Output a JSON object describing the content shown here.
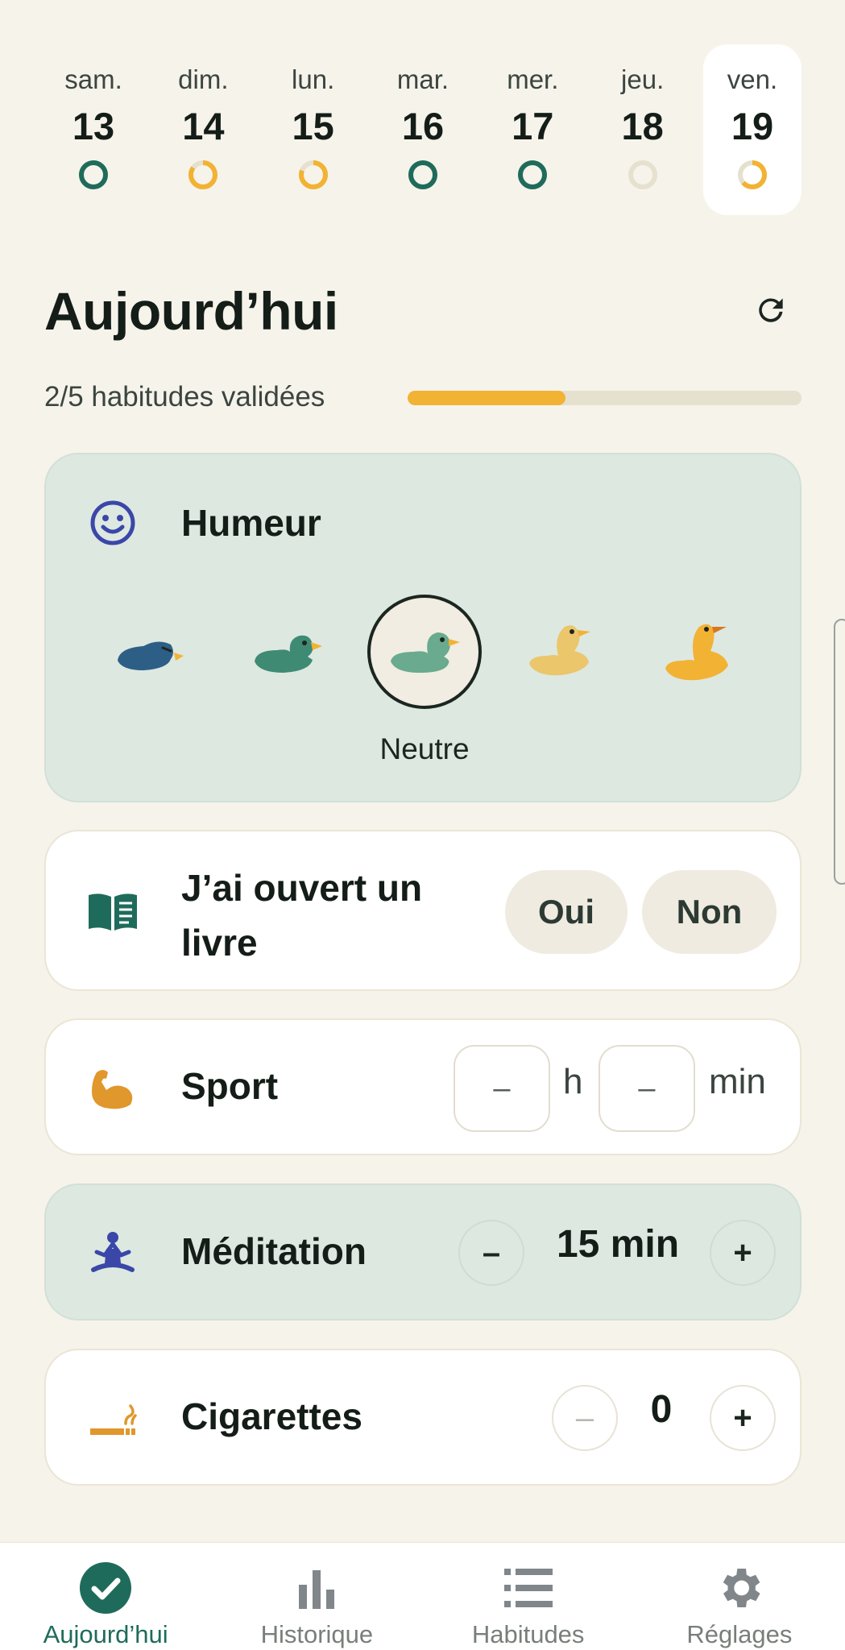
{
  "days": [
    {
      "name": "sam.",
      "num": "13",
      "status": "complete"
    },
    {
      "name": "dim.",
      "num": "14",
      "status": "partial"
    },
    {
      "name": "lun.",
      "num": "15",
      "status": "partial"
    },
    {
      "name": "mar.",
      "num": "16",
      "status": "complete"
    },
    {
      "name": "mer.",
      "num": "17",
      "status": "complete"
    },
    {
      "name": "jeu.",
      "num": "18",
      "status": "empty"
    },
    {
      "name": "ven.",
      "num": "19",
      "status": "partial",
      "selected": true
    }
  ],
  "header": {
    "title": "Aujourd’hui",
    "progress_label": "2/5 habitudes validées",
    "progress_fraction": 0.4
  },
  "mood": {
    "label": "Humeur",
    "selected_index": 2,
    "selected_caption": "Neutre",
    "options": [
      "very-sad-duck",
      "sad-duck",
      "neutral-duck",
      "happy-duck",
      "very-happy-duck"
    ]
  },
  "book": {
    "label": "J’ai ouvert un livre",
    "yes_label": "Oui",
    "no_label": "Non"
  },
  "sport": {
    "label": "Sport",
    "hours_value": "–",
    "hours_unit": "h",
    "minutes_value": "–",
    "minutes_unit": "min"
  },
  "meditation": {
    "label": "Méditation",
    "minus": "–",
    "value": "15 min",
    "plus": "+"
  },
  "cigarettes": {
    "label": "Cigarettes",
    "minus": "–",
    "value": "0",
    "plus": "+"
  },
  "nav": [
    {
      "label": "Aujourd’hui",
      "icon": "check-circle-icon",
      "active": true
    },
    {
      "label": "Historique",
      "icon": "bar-chart-icon",
      "active": false
    },
    {
      "label": "Habitudes",
      "icon": "list-icon",
      "active": false
    },
    {
      "label": "Réglages",
      "icon": "gear-icon",
      "active": false
    }
  ],
  "colors": {
    "background": "#f6f3ea",
    "accent_green": "#1f6b5b",
    "accent_yellow": "#f2b233",
    "tint_card": "#dde8e1"
  }
}
